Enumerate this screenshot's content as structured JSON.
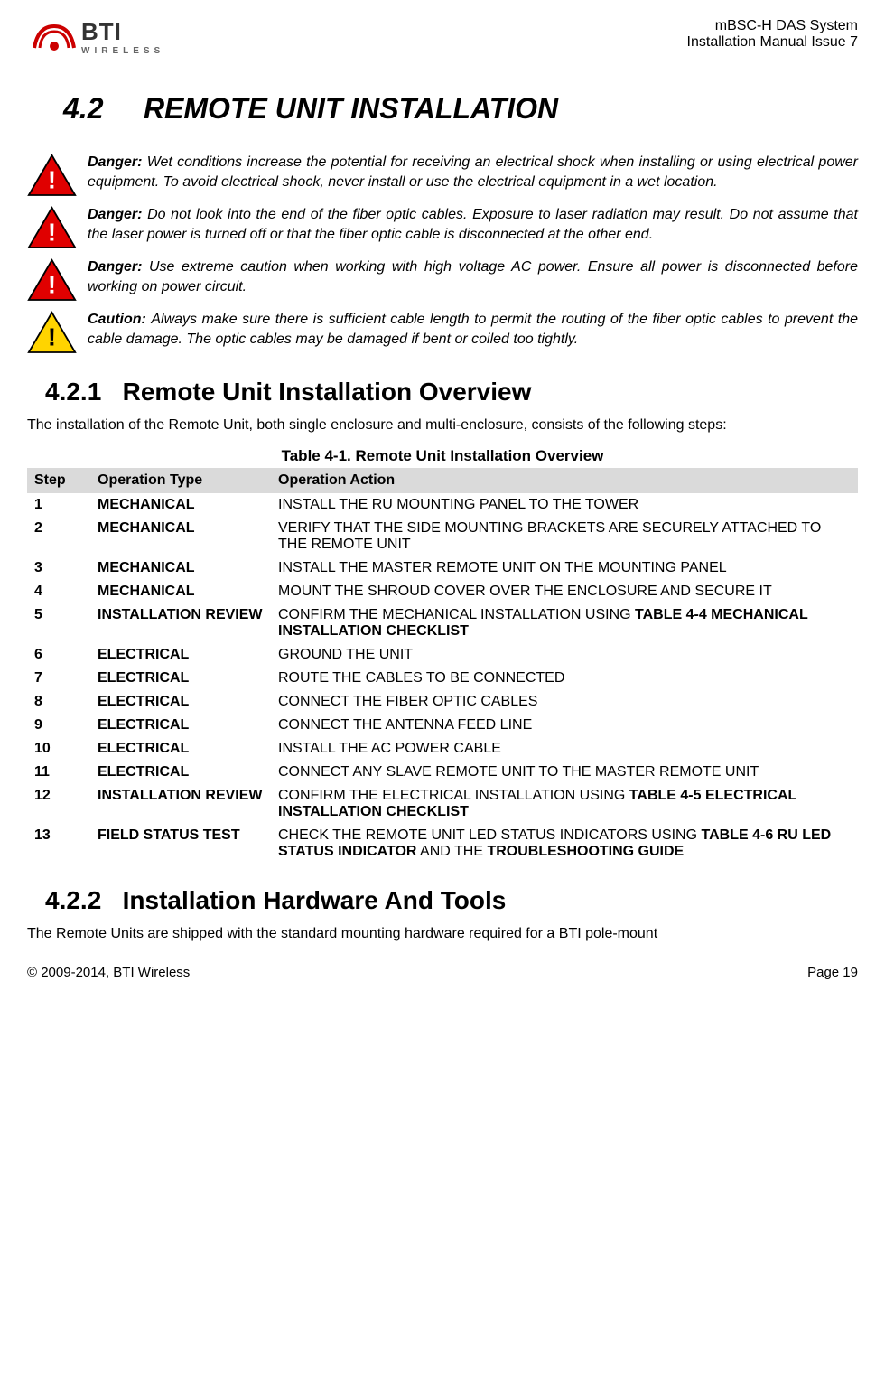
{
  "header": {
    "logo_main": "BTI",
    "logo_sub": "WIRELESS",
    "right_line1": "mBSC-H DAS System",
    "right_line2": "Installation Manual Issue 7"
  },
  "section": {
    "number": "4.2",
    "title": "REMOTE UNIT INSTALLATION"
  },
  "warnings": [
    {
      "type": "danger",
      "label": "Danger:",
      "text": "Wet conditions increase the potential for receiving an electrical shock when installing or using electrical power equipment. To avoid electrical shock, never install or use the electrical equipment in a wet location."
    },
    {
      "type": "danger",
      "label": "Danger:",
      "text": "Do not look into the end of the fiber optic cables. Exposure to laser radiation may result. Do not assume that the laser power is turned off or that the fiber optic cable is disconnected at the other end."
    },
    {
      "type": "danger",
      "label": "Danger:",
      "text": "Use extreme caution when working with high voltage AC power. Ensure all power is disconnected before working on power circuit."
    },
    {
      "type": "caution",
      "label": "Caution:",
      "text": "Always make sure there is sufficient cable length to permit the routing of the fiber optic cables to prevent the cable damage. The optic cables may be damaged if bent or coiled too tightly."
    }
  ],
  "subsection1": {
    "number": "4.2.1",
    "title": "Remote Unit Installation Overview",
    "intro": "The installation of the Remote Unit, both single enclosure and multi-enclosure, consists of the following steps:"
  },
  "table": {
    "caption": "Table 4-1. Remote Unit Installation Overview",
    "headers": {
      "step": "Step",
      "type": "Operation Type",
      "action": "Operation Action"
    },
    "rows": [
      {
        "step": "1",
        "type": "MECHANICAL",
        "action_parts": [
          {
            "t": "INSTALL THE RU MOUNTING PANEL TO THE TOWER",
            "b": false
          }
        ]
      },
      {
        "step": "2",
        "type": "MECHANICAL",
        "action_parts": [
          {
            "t": "VERIFY THAT THE SIDE MOUNTING BRACKETS ARE SECURELY ATTACHED TO THE REMOTE UNIT",
            "b": false
          }
        ]
      },
      {
        "step": "3",
        "type": "MECHANICAL",
        "action_parts": [
          {
            "t": "INSTALL THE MASTER REMOTE UNIT ON THE MOUNTING PANEL",
            "b": false
          }
        ]
      },
      {
        "step": "4",
        "type": "MECHANICAL",
        "action_parts": [
          {
            "t": "MOUNT THE SHROUD COVER OVER THE ENCLOSURE AND SECURE IT",
            "b": false
          }
        ]
      },
      {
        "step": "5",
        "type": "INSTALLATION REVIEW",
        "action_parts": [
          {
            "t": "CONFIRM THE MECHANICAL INSTALLATION USING ",
            "b": false
          },
          {
            "t": "TABLE 4-4 MECHANICAL INSTALLATION CHECKLIST",
            "b": true
          }
        ]
      },
      {
        "step": "6",
        "type": "ELECTRICAL",
        "action_parts": [
          {
            "t": "GROUND THE UNIT",
            "b": false
          }
        ]
      },
      {
        "step": "7",
        "type": "ELECTRICAL",
        "action_parts": [
          {
            "t": "ROUTE THE CABLES TO BE CONNECTED",
            "b": false
          }
        ]
      },
      {
        "step": "8",
        "type": "ELECTRICAL",
        "action_parts": [
          {
            "t": "CONNECT THE FIBER OPTIC CABLES",
            "b": false
          }
        ]
      },
      {
        "step": "9",
        "type": "ELECTRICAL",
        "action_parts": [
          {
            "t": "CONNECT THE ANTENNA FEED LINE",
            "b": false
          }
        ]
      },
      {
        "step": "10",
        "type": "ELECTRICAL",
        "action_parts": [
          {
            "t": "INSTALL THE AC POWER CABLE",
            "b": false
          }
        ]
      },
      {
        "step": "11",
        "type": "ELECTRICAL",
        "action_parts": [
          {
            "t": "CONNECT ANY SLAVE REMOTE UNIT TO THE MASTER REMOTE UNIT",
            "b": false
          }
        ]
      },
      {
        "step": "12",
        "type": "INSTALLATION REVIEW",
        "action_parts": [
          {
            "t": "CONFIRM THE ELECTRICAL INSTALLATION USING ",
            "b": false
          },
          {
            "t": "TABLE 4-5 ELECTRICAL INSTALLATION CHECKLIST",
            "b": true
          }
        ]
      },
      {
        "step": "13",
        "type": "FIELD STATUS TEST",
        "action_parts": [
          {
            "t": "CHECK THE REMOTE UNIT LED STATUS INDICATORS USING ",
            "b": false
          },
          {
            "t": "TABLE 4-6   RU LED STATUS INDICATOR",
            "b": true
          },
          {
            "t": " AND THE ",
            "b": false
          },
          {
            "t": "TROUBLESHOOTING GUIDE",
            "b": true
          }
        ]
      }
    ]
  },
  "subsection2": {
    "number": "4.2.2",
    "title": "Installation Hardware And Tools",
    "intro": "The Remote Units are shipped with the standard mounting hardware required for a BTI pole-mount"
  },
  "footer": {
    "left": "© 2009-2014, BTI Wireless",
    "right": "Page 19"
  }
}
